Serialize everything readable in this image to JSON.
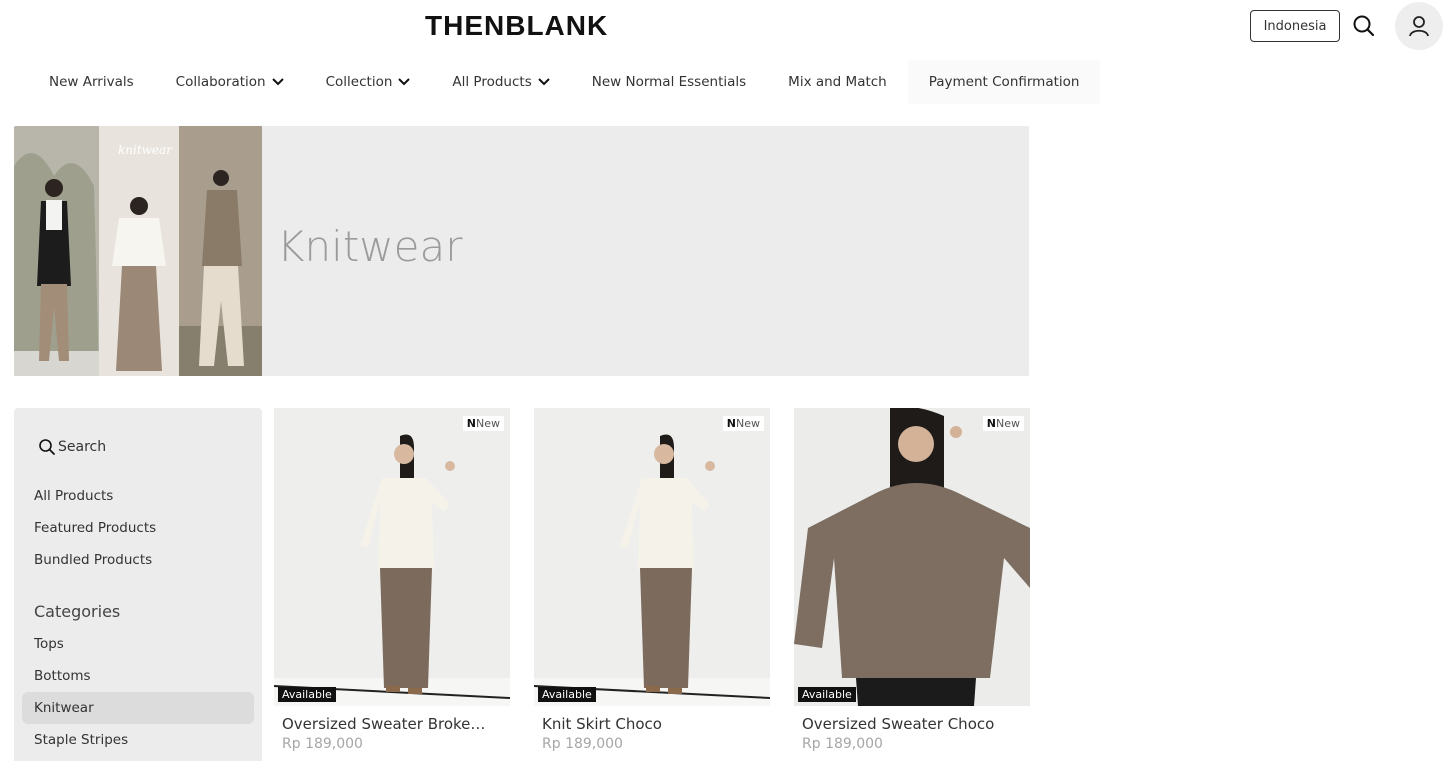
{
  "header": {
    "logo": "THENBLANK",
    "region": "Indonesia",
    "icons": [
      "search-icon",
      "user-icon"
    ]
  },
  "nav": {
    "items": [
      {
        "label": "New Arrivals",
        "dropdown": false
      },
      {
        "label": "Collaboration",
        "dropdown": true
      },
      {
        "label": "Collection",
        "dropdown": true
      },
      {
        "label": "All Products",
        "dropdown": true
      },
      {
        "label": "New Normal Essentials",
        "dropdown": false
      },
      {
        "label": "Mix and Match",
        "dropdown": false
      },
      {
        "label": "Payment Confirmation",
        "dropdown": false
      }
    ]
  },
  "banner": {
    "title": "Knitwear",
    "image_text": "knitwear"
  },
  "sidebar": {
    "search_label": "Search",
    "links": [
      "All Products",
      "Featured Products",
      "Bundled Products"
    ],
    "categories_heading": "Categories",
    "categories": [
      "Tops",
      "Bottoms",
      "Knitwear",
      "Staple Stripes"
    ],
    "active_category": "Knitwear"
  },
  "products": [
    {
      "name": "Oversized Sweater Broken ...",
      "price": "Rp 189,000",
      "badge_new_letter": "N",
      "badge_new": "New",
      "status": "Available"
    },
    {
      "name": "Knit Skirt Choco",
      "price": "Rp 189,000",
      "badge_new_letter": "N",
      "badge_new": "New",
      "status": "Available"
    },
    {
      "name": "Oversized Sweater Choco",
      "price": "Rp 189,000",
      "badge_new_letter": "N",
      "badge_new": "New",
      "status": "Available"
    }
  ],
  "colors": {
    "panel": "#ececec",
    "accent": "#111111",
    "price": "#a6a6a6"
  }
}
